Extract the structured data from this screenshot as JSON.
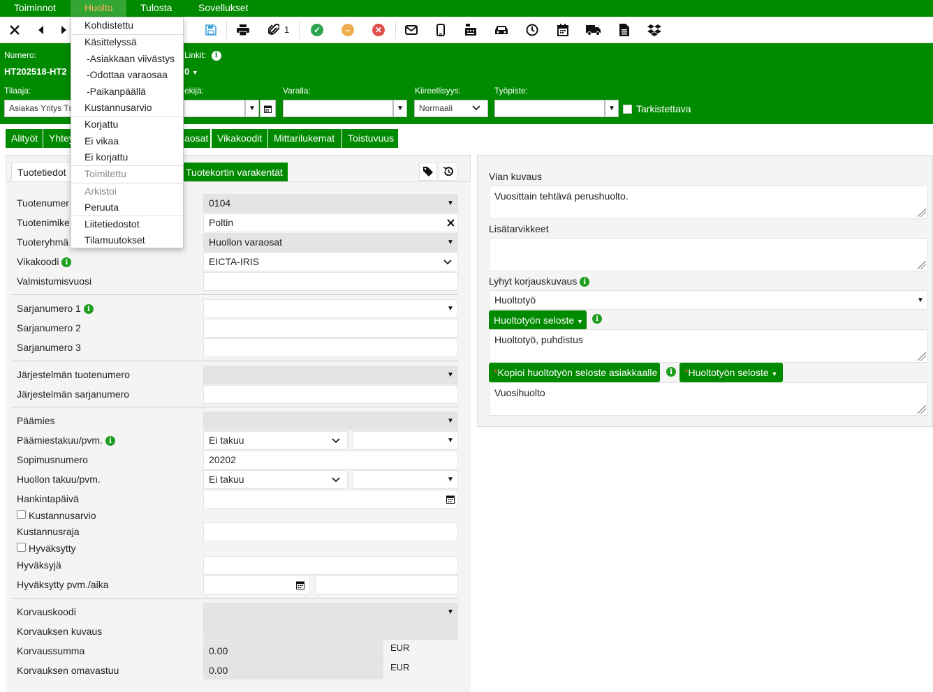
{
  "menubar": {
    "items": [
      "Toiminnot",
      "Huolto",
      "Tulosta",
      "Sovellukset"
    ],
    "active": "Huolto"
  },
  "toolbar": {
    "attachment_count": "1",
    "icons": [
      "close-icon",
      "prev-icon",
      "next-icon",
      "save-icon",
      "print-icon",
      "paperclip-icon",
      "approve-icon",
      "pending-icon",
      "reject-icon",
      "mail-icon",
      "mobile-icon",
      "cash-register-icon",
      "car-icon",
      "clock-icon",
      "calendar-icon",
      "truck-icon",
      "document-icon",
      "dropbox-icon"
    ],
    "colors": {
      "approve": "#2ea44f",
      "pending": "#f0ad4e",
      "reject": "#e0504a"
    }
  },
  "header": {
    "numero_label": "Numero:",
    "numero_value": "HT202518-HT2",
    "linkit_label": "Linkit:",
    "linkit_value": "0",
    "tilaaja_label": "Tilaaja:",
    "tilaaja_value": "Asiakas Yritys Tm",
    "tekija_label": "ekijä:",
    "varalla_label": "Varalla:",
    "kiireellisyys_label": "Kiireellisyys:",
    "kiireellisyys_value": "Normaali",
    "tyopiste_label": "Työpiste:",
    "tarkistettava_label": "Tarkistettava"
  },
  "tabs": [
    "Alityöt",
    "Yhtey",
    "aosat",
    "Vikakoodit",
    "Mittarilukemat",
    "Toistuvuus"
  ],
  "subtabs": {
    "tuotetiedot": "Tuotetiedot",
    "varakentat": "Tuotekortin varakentät"
  },
  "form": {
    "tuotenumero_label": "Tuotenumer",
    "tuotenumero_value": "0104",
    "tuotenimike_label": "Tuotenimike",
    "tuotenimike_value": "Poltin",
    "tuoteryhma_label": "Tuoteryhmä",
    "tuoteryhma_value": "Huollon varaosat",
    "vikakoodi_label": "Vikakoodi",
    "vikakoodi_value": "EICTA-IRIS",
    "valmistumisvuosi_label": "Valmistumisvuosi",
    "sarjanumero1_label": "Sarjanumero 1",
    "sarjanumero2_label": "Sarjanumero 2",
    "sarjanumero3_label": "Sarjanumero 3",
    "jarj_tuotenumero_label": "Järjestelmän tuotenumero",
    "jarj_sarjanumero_label": "Järjestelmän sarjanumero",
    "paamies_label": "Päämies",
    "paamiestakuu_label": "Päämiestakuu/pvm.",
    "paamiestakuu_value": "Ei takuu",
    "sopimusnumero_label": "Sopimusnumero",
    "sopimusnumero_value": "20202",
    "huollon_takuu_label": "Huollon takuu/pvm.",
    "huollon_takuu_value": "Ei takuu",
    "hankintapaiva_label": "Hankintapäivä",
    "kustannusarvio_label": "Kustannusarvio",
    "kustannusraja_label": "Kustannusraja",
    "hyvaksytty_label": "Hyväksytty",
    "hyvaksyja_label": "Hyväksyjä",
    "hyvaksytty_pvm_label": "Hyväksytty pvm./aika",
    "korvauskoodi_label": "Korvauskoodi",
    "korvauksen_kuvaus_label": "Korvauksen kuvaus",
    "korvaussumma_label": "Korvaussumma",
    "korvaussumma_value": "0.00",
    "korvaussumma_unit": "EUR",
    "omavastuu_label": "Korvauksen omavastuu",
    "omavastuu_value": "0.00",
    "omavastuu_unit": "EUR"
  },
  "right": {
    "vian_kuvaus_label": "Vian kuvaus",
    "vian_kuvaus_value": "Vuosittain tehtävä perushuolto.",
    "lisatarvikkeet_label": "Lisätarvikkeet",
    "lyhyt_label": "Lyhyt korjauskuvaus",
    "lyhyt_value": "Huoltotyö",
    "seloste_button": "Huoltotyön seloste",
    "seloste_value": "Huoltotyö, puhdistus",
    "kopioi_button": "Kopioi huoltotyön seloste asiakkaalle",
    "seloste2_button": "Huoltotyön seloste",
    "asiakas_seloste_value": "Vuosihuolto"
  },
  "dropdown": {
    "items": [
      "Kohdistettu",
      "Käsittelyssä",
      "-Asiakkaan viivästys",
      "-Odottaa varaosaa",
      "-Paikanpäällä",
      "Kustannusarvio",
      "Korjattu",
      "Ei vikaa",
      "Ei korjattu",
      "Toimitettu",
      "Arkistoi",
      "Peruuta",
      "Liitetiedostot",
      "Tilamuutokset"
    ]
  }
}
